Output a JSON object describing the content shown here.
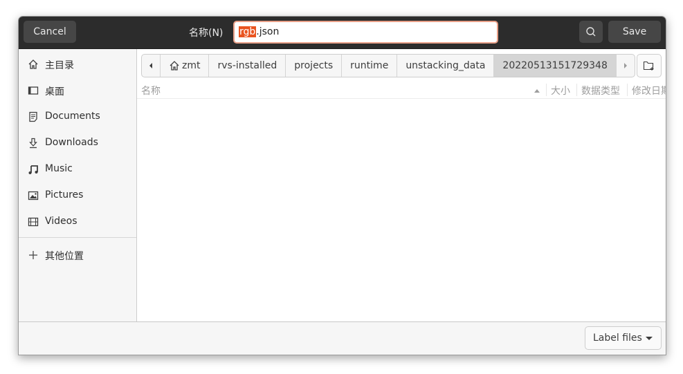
{
  "header": {
    "cancel_label": "Cancel",
    "name_label": "名称(N)",
    "filename_selected": "rgb",
    "filename_rest": ".json",
    "search_icon": "search-icon",
    "save_label": "Save"
  },
  "sidebar": {
    "items": [
      {
        "label": "主目录",
        "icon": "home-icon"
      },
      {
        "label": "桌面",
        "icon": "desktop-icon"
      },
      {
        "label": "Documents",
        "icon": "document-icon"
      },
      {
        "label": "Downloads",
        "icon": "download-icon"
      },
      {
        "label": "Music",
        "icon": "music-icon"
      },
      {
        "label": "Pictures",
        "icon": "picture-icon"
      },
      {
        "label": "Videos",
        "icon": "video-icon"
      }
    ],
    "other_locations": {
      "label": "其他位置",
      "icon": "plus-icon"
    }
  },
  "pathbar": {
    "segments": [
      "zmt",
      "rvs-installed",
      "projects",
      "runtime",
      "unstacking_data",
      "20220513151729348"
    ],
    "active_index": 5
  },
  "columns": {
    "name": "名称",
    "size": "大小",
    "type": "数据类型",
    "modified": "修改日期"
  },
  "footer": {
    "label_files": "Label files"
  }
}
